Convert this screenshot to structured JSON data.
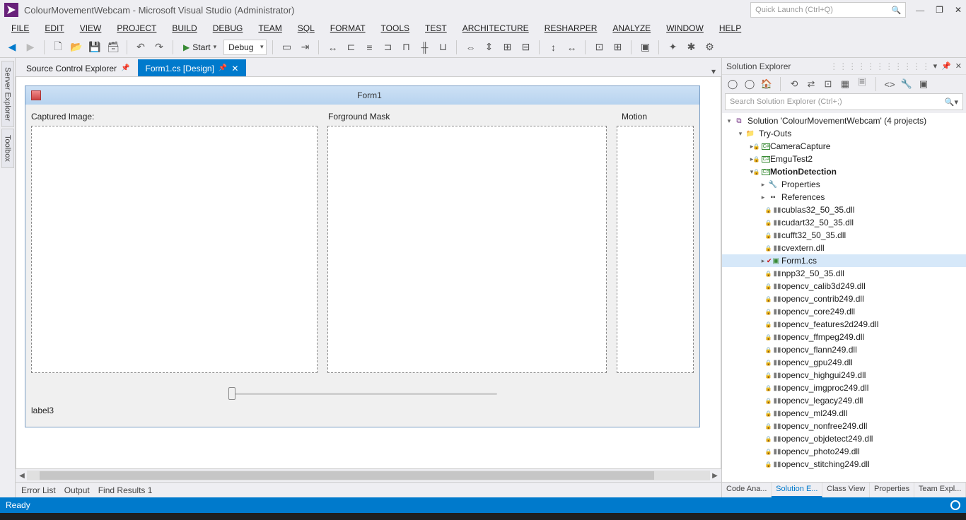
{
  "window": {
    "title": "ColourMovementWebcam - Microsoft Visual Studio (Administrator)",
    "quick_launch_placeholder": "Quick Launch (Ctrl+Q)"
  },
  "menu": [
    "FILE",
    "EDIT",
    "VIEW",
    "PROJECT",
    "BUILD",
    "DEBUG",
    "TEAM",
    "SQL",
    "FORMAT",
    "TOOLS",
    "TEST",
    "ARCHITECTURE",
    "RESHARPER",
    "ANALYZE",
    "WINDOW",
    "HELP"
  ],
  "toolbar": {
    "start_label": "Start",
    "config_label": "Debug"
  },
  "doc_tabs": {
    "tab1": "Source Control Explorer",
    "tab2": "Form1.cs [Design]"
  },
  "form": {
    "title": "Form1",
    "labels": {
      "captured": "Captured Image:",
      "mask": "Forground Mask",
      "motion": "Motion"
    },
    "label3": "label3"
  },
  "solution_explorer": {
    "title": "Solution Explorer",
    "search_placeholder": "Search Solution Explorer (Ctrl+;)",
    "root": "Solution 'ColourMovementWebcam' (4 projects)",
    "folder": "Try-Outs",
    "projects": {
      "p1": "CameraCapture",
      "p2": "EmguTest2",
      "p3": "MotionDetection"
    },
    "props": "Properties",
    "refs": "References",
    "files": [
      "cublas32_50_35.dll",
      "cudart32_50_35.dll",
      "cufft32_50_35.dll",
      "cvextern.dll",
      "Form1.cs",
      "npp32_50_35.dll",
      "opencv_calib3d249.dll",
      "opencv_contrib249.dll",
      "opencv_core249.dll",
      "opencv_features2d249.dll",
      "opencv_ffmpeg249.dll",
      "opencv_flann249.dll",
      "opencv_gpu249.dll",
      "opencv_highgui249.dll",
      "opencv_imgproc249.dll",
      "opencv_legacy249.dll",
      "opencv_ml249.dll",
      "opencv_nonfree249.dll",
      "opencv_objdetect249.dll",
      "opencv_photo249.dll",
      "opencv_stitching249.dll"
    ]
  },
  "bottom_tabs": {
    "t1": "Error List",
    "t2": "Output",
    "t3": "Find Results 1"
  },
  "right_tabs": {
    "r1": "Code Ana...",
    "r2": "Solution E...",
    "r3": "Class View",
    "r4": "Properties",
    "r5": "Team Expl..."
  },
  "status": {
    "ready": "Ready"
  },
  "left_rail": {
    "t1": "Server Explorer",
    "t2": "Toolbox"
  }
}
